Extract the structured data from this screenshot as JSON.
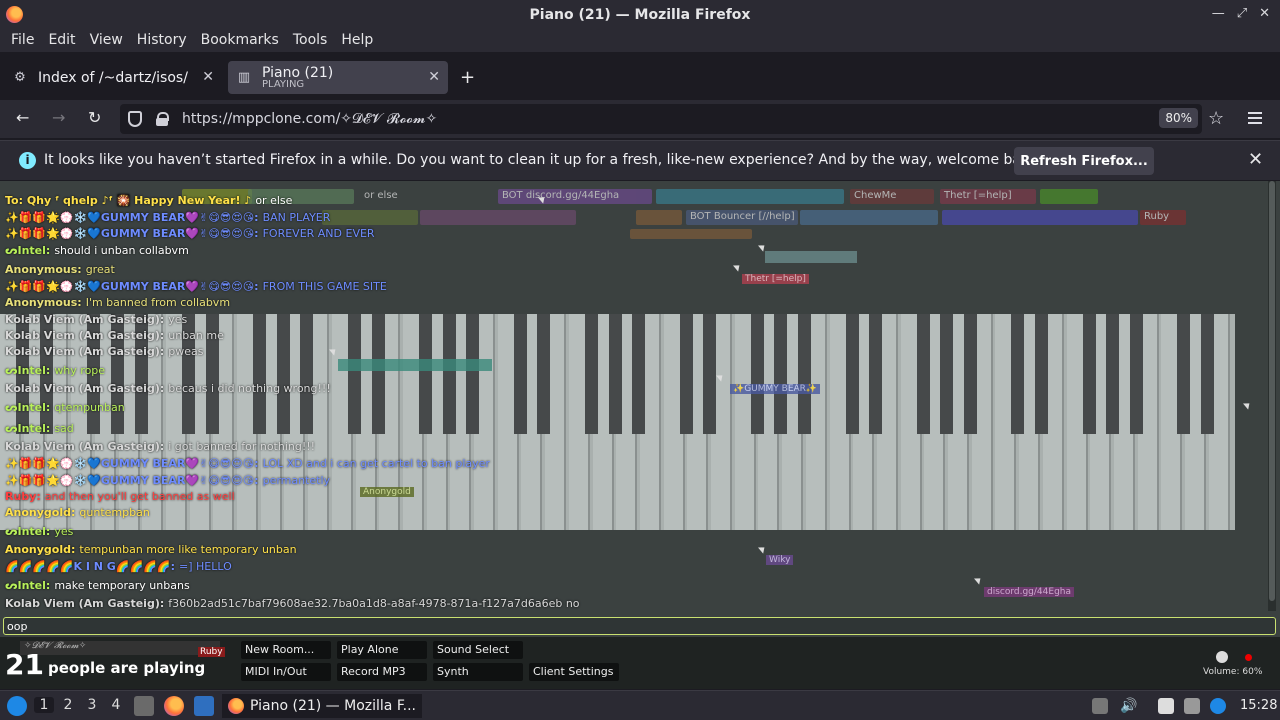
{
  "window": {
    "title": "Piano (21) — Mozilla Firefox"
  },
  "menu": [
    "File",
    "Edit",
    "View",
    "History",
    "Bookmarks",
    "Tools",
    "Help"
  ],
  "tabs": [
    {
      "label": "Index of /~dartz/isos/",
      "sub": ""
    },
    {
      "label": "Piano (21)",
      "sub": "PLAYING"
    }
  ],
  "nav": {
    "url": "https://mppclone.com/✧𝓓𝓔𝓥 𝓡𝓸𝓸𝓶✧",
    "zoom": "80%"
  },
  "notification": {
    "message": "It looks like you haven’t started Firefox in a while. Do you want to clean it up for a fresh, like-new experience? And by the way, welcome back!",
    "button": "Refresh Firefox..."
  },
  "tags": [
    {
      "text": "To: Qhy ᶠ qhelp ♪ᶠ 🎇 Happy New Year! ♪",
      "color": "#3a3aa8"
    },
    {
      "text": "or else",
      "color": "#555"
    },
    {
      "text": "BOT discord.gg/44Egha",
      "color": "#7a4a8a"
    },
    {
      "text": "ChewMe",
      "color": "#6a4a30"
    },
    {
      "text": "Thetr [=help]",
      "color": "#8a3a3a"
    },
    {
      "text": "BOT Bouncer [//help]",
      "color": "#4a5a7a"
    },
    {
      "text": "Ruby",
      "color": "#8a3030"
    }
  ],
  "chat": [
    {
      "name": "To: Qhy ᶠ qhelp ♪ᶠ 🎇 Happy New Year! ♪",
      "nameColor": "#ffe14a",
      "text": "or else",
      "textColor": "#ffffff"
    },
    {
      "name": "✨🎁🎁🌟💮❄️💙GUMMY BEAR💜✌😋😎😍😘:",
      "nameColor": "#6e8cff",
      "text": "BAN PLAYER",
      "textColor": "#6e8cff"
    },
    {
      "name": "✨🎁🎁🌟💮❄️💙GUMMY BEAR💜✌😋😎😍😘:",
      "nameColor": "#6e8cff",
      "text": "FOREVER AND EVER",
      "textColor": "#6e8cff"
    },
    {
      "name": "ᔕIntel:",
      "nameColor": "#b8f05a",
      "text": "should i unban collabvm",
      "textColor": "#ffffff"
    },
    {
      "name": "Anonymous:",
      "nameColor": "#e8e07a",
      "text": "great",
      "textColor": "#e8e07a"
    },
    {
      "name": "✨🎁🎁🌟💮❄️💙GUMMY BEAR💜✌😋😎😍😘:",
      "nameColor": "#6e8cff",
      "text": "FROM THIS GAME SITE",
      "textColor": "#6e8cff"
    },
    {
      "name": "Anonymous:",
      "nameColor": "#e8e07a",
      "text": "I'm banned from collabvm",
      "textColor": "#e8e07a"
    },
    {
      "name": "Kolab Viem (Am Gasteig):",
      "nameColor": "#d8d8d8",
      "text": "yes",
      "textColor": "#d8d8d8"
    },
    {
      "name": "Kolab Viem (Am Gasteig):",
      "nameColor": "#d8d8d8",
      "text": "unban me",
      "textColor": "#d8d8d8"
    },
    {
      "name": "Kolab Viem (Am Gasteig):",
      "nameColor": "#d8d8d8",
      "text": "pweas",
      "textColor": "#d8d8d8"
    },
    {
      "name": "ᔕIntel:",
      "nameColor": "#b8f05a",
      "text": "why rope",
      "textColor": "#b8f05a"
    },
    {
      "name": "Kolab Viem (Am Gasteig):",
      "nameColor": "#d8d8d8",
      "text": "becaus i did nothing wrong!!!",
      "textColor": "#d8d8d8"
    },
    {
      "name": "ᔕIntel:",
      "nameColor": "#b8f05a",
      "text": "qtempunban",
      "textColor": "#b8f05a"
    },
    {
      "name": "ᔕIntel:",
      "nameColor": "#b8f05a",
      "text": "sad",
      "textColor": "#b8f05a"
    },
    {
      "name": "Kolab Viem (Am Gasteig):",
      "nameColor": "#d8d8d8",
      "text": "i got banned for nothing!!!",
      "textColor": "#d8d8d8"
    },
    {
      "name": "✨🎁🎁🌟💮❄️💙GUMMY BEAR💜✌😋😎😍😘:",
      "nameColor": "#6e8cff",
      "text": "LOL XD and i can get cartel to ban player",
      "textColor": "#6e8cff"
    },
    {
      "name": "✨🎁🎁🌟💮❄️💙GUMMY BEAR💜✌😋😎😍😘:",
      "nameColor": "#6e8cff",
      "text": "permantetly",
      "textColor": "#6e8cff"
    },
    {
      "name": "Ruby:",
      "nameColor": "#ff4040",
      "text": "and then you'll get banned as well",
      "textColor": "#ff4040"
    },
    {
      "name": "Anonygold:",
      "nameColor": "#ffe14a",
      "text": "quntempban",
      "textColor": "#ffe14a"
    },
    {
      "name": "ᔕIntel:",
      "nameColor": "#b8f05a",
      "text": "yes",
      "textColor": "#b8f05a"
    },
    {
      "name": "Anonygold:",
      "nameColor": "#ffe14a",
      "text": "tempunban more like temporary unban",
      "textColor": "#ffe14a"
    },
    {
      "name": "🌈🌈🌈🌈🌈K I N G🌈🌈🌈🌈:",
      "nameColor": "#6e8cff",
      "text": "=] HELLO",
      "textColor": "#6e8cff"
    },
    {
      "name": "ᔕIntel:",
      "nameColor": "#b8f05a",
      "text": "make temporary unbans",
      "textColor": "#ffffff"
    },
    {
      "name": "Kolab Viem (Am Gasteig):",
      "nameColor": "#d8d8d8",
      "text": "f360b2ad51c7baf79608ae32.7ba0a1d8-a8af-4978-871a-f127a7d6a6eb no",
      "textColor": "#d8d8d8"
    }
  ],
  "chatInput": {
    "value": "oop"
  },
  "bottom": {
    "room": "✧𝓓𝓔𝓥 𝓡𝓸𝓸𝓶✧",
    "ruby": "Ruby",
    "count": "21",
    "countText": "people are playing",
    "buttons": [
      "New Room...",
      "Play Alone",
      "Sound Select",
      "MIDI In/Out",
      "Record MP3",
      "Synth",
      "Client Settings"
    ],
    "volume": "Volume: 60%"
  },
  "taskbar": {
    "workspaces": [
      "1",
      "2",
      "3",
      "4"
    ],
    "task": "Piano (21) — Mozilla F...",
    "clock": "15:28"
  },
  "ghosts": [
    {
      "text": "Thetr [=help]",
      "color": "#c0405a"
    },
    {
      "text": "Anonygold",
      "color": "#6a7a30"
    },
    {
      "text": "Wiky",
      "color": "#7a5aa0"
    },
    {
      "text": "discord.gg/44Egha",
      "color": "#8a4a8a"
    },
    {
      "text": "✨GUMMY BEAR✨",
      "color": "#5a6aa8"
    }
  ]
}
